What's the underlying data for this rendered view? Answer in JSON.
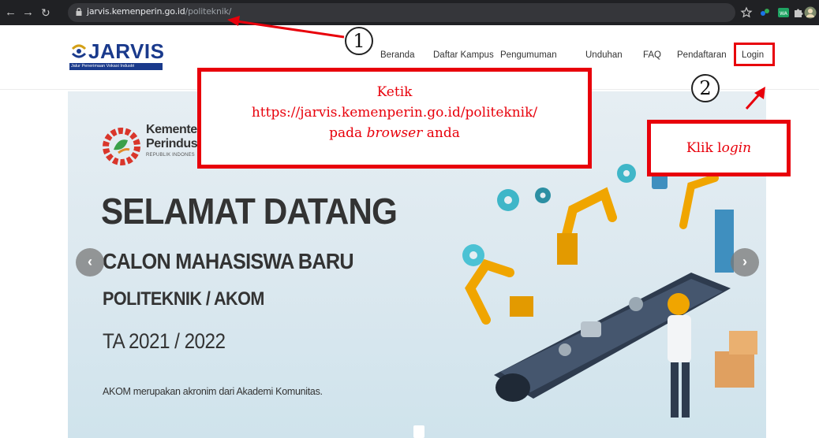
{
  "browser": {
    "url_host": "jarvis.kemenperin.go.id",
    "url_path": "/politeknik/",
    "back_icon": "arrow-left-icon",
    "forward_icon": "arrow-right-icon",
    "reload_icon": "reload-icon"
  },
  "site": {
    "logo_text": "JARVIS",
    "logo_tagline": "Jalur Penerimaan Vokasi Industri",
    "nav": [
      "Beranda",
      "Daftar Kampus",
      "Pengumuman",
      "Unduhan",
      "FAQ",
      "Pendaftaran",
      "Login"
    ]
  },
  "hero": {
    "kemen_line1": "Kementeria",
    "kemen_line2": "Perindustria",
    "kemen_line3": "REPUBLIK INDONES",
    "title": "SELAMAT DATANG",
    "subtitle1": "CALON MAHASISWA BARU",
    "subtitle2": "POLITEKNIK / AKOM",
    "subtitle3": "TA 2021 / 2022",
    "note": "AKOM merupakan akronim dari Akademi Komunitas.",
    "prev_label": "‹",
    "next_label": "›"
  },
  "annotations": {
    "step1": "1",
    "step2": "2",
    "box1_line1": "Ketik",
    "box1_line2": "https://jarvis.kemenperin.go.id/politeknik/",
    "box1_line3_pre": "pada ",
    "box1_line3_em": "browser",
    "box1_line3_post": " anda",
    "box2_pre": "Klik l",
    "box2_em": "ogin",
    "color": "#e8000b"
  }
}
